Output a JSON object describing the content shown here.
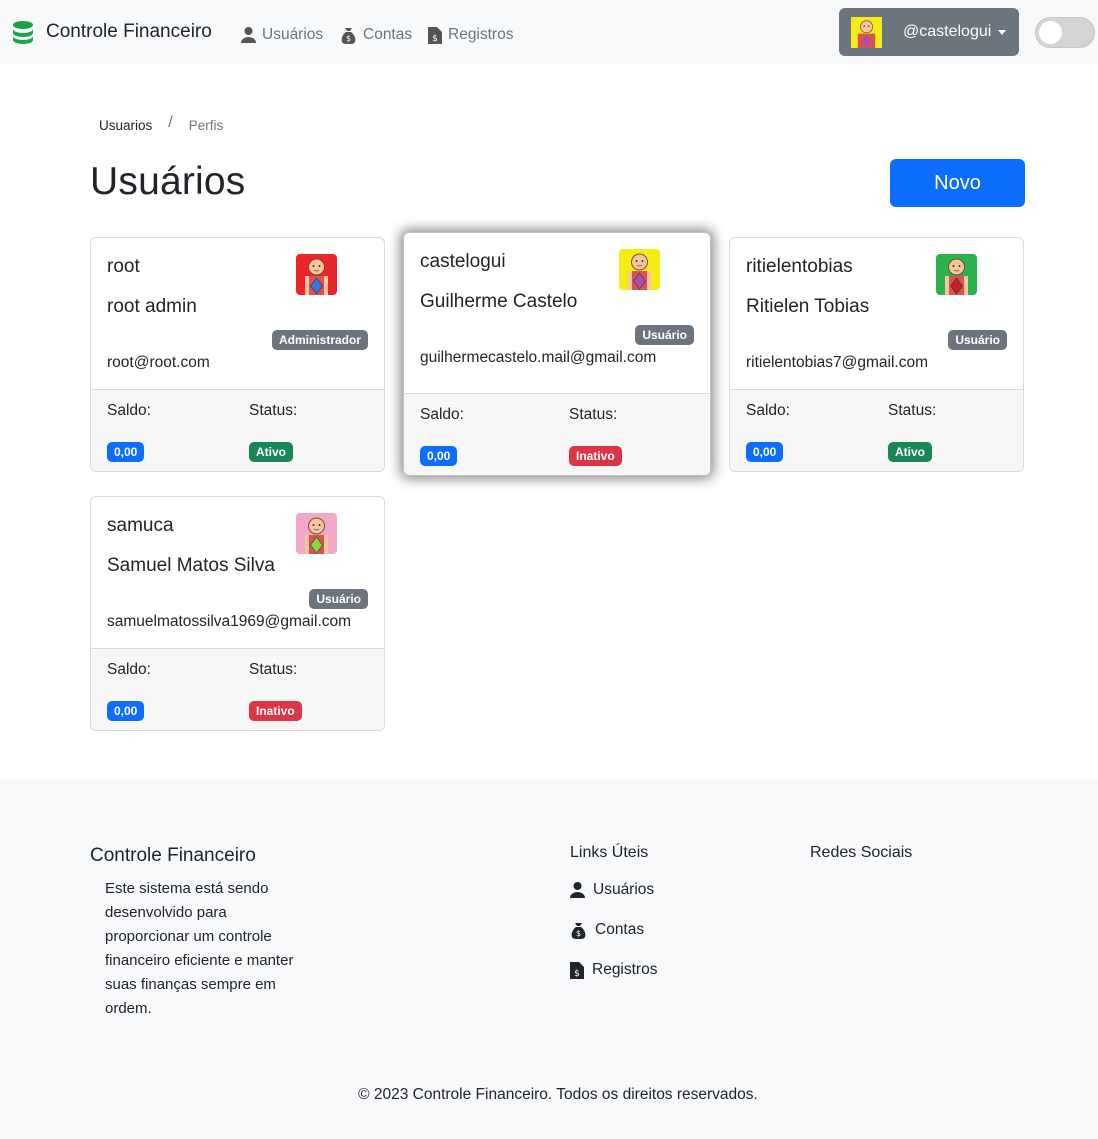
{
  "navbar": {
    "brand": "Controle Financeiro",
    "items": [
      {
        "label": "Usuários",
        "icon": "user-icon"
      },
      {
        "label": "Contas",
        "icon": "money-bag-icon"
      },
      {
        "label": "Registros",
        "icon": "receipt-icon"
      }
    ],
    "user": "@castelogui",
    "theme_toggle_on": false
  },
  "breadcrumb": {
    "home": "Usuarios",
    "separator": "/",
    "active": "Perfis"
  },
  "page": {
    "title": "Usuários",
    "new_button": "Novo"
  },
  "labels": {
    "saldo": "Saldo:",
    "status": "Status:"
  },
  "users": [
    {
      "username": "root",
      "name": "root admin",
      "role": "Administrador",
      "email": "root@root.com",
      "saldo": "0,00",
      "status": "Ativo",
      "status_color": "#198754",
      "avatar_bg": "#e8262b",
      "avatar_shirt": "#3d6fe0"
    },
    {
      "username": "castelogui",
      "name": "Guilherme Castelo",
      "role": "Usuário",
      "email": "guilhermecastelo.mail@gmail.com",
      "saldo": "0,00",
      "status": "Inativo",
      "status_color": "#dc3545",
      "avatar_bg": "#f5ec16",
      "avatar_shirt": "#b04aa8"
    },
    {
      "username": "ritielentobias",
      "name": "Ritielen Tobias",
      "role": "Usuário",
      "email": "ritielentobias7@gmail.com",
      "saldo": "0,00",
      "status": "Ativo",
      "status_color": "#198754",
      "avatar_bg": "#2bb24c",
      "avatar_shirt": "#c0202a"
    },
    {
      "username": "samuca",
      "name": "Samuel Matos Silva",
      "role": "Usuário",
      "email": "samuelmatossilva1969@gmail.com",
      "saldo": "0,00",
      "status": "Inativo",
      "status_color": "#dc3545",
      "avatar_bg": "#f4a8c8",
      "avatar_shirt": "#8bd640"
    }
  ],
  "footer": {
    "brand": "Controle Financeiro",
    "description": "Este sistema está sendo desenvolvido para proporcionar um controle financeiro eficiente e manter suas finanças sempre em ordem.",
    "links_title": "Links Úteis",
    "links": [
      {
        "label": "Usuários",
        "icon": "user-icon"
      },
      {
        "label": "Contas",
        "icon": "money-bag-icon"
      },
      {
        "label": "Registros",
        "icon": "receipt-icon"
      }
    ],
    "social_title": "Redes Sociais",
    "copyright": "© 2023 Controle Financeiro. Todos os direitos reservados."
  },
  "colors": {
    "primary": "#0d6efd",
    "secondary": "#6c757d",
    "success": "#198754",
    "danger": "#dc3545",
    "brand_icon": "#1aa34a"
  }
}
